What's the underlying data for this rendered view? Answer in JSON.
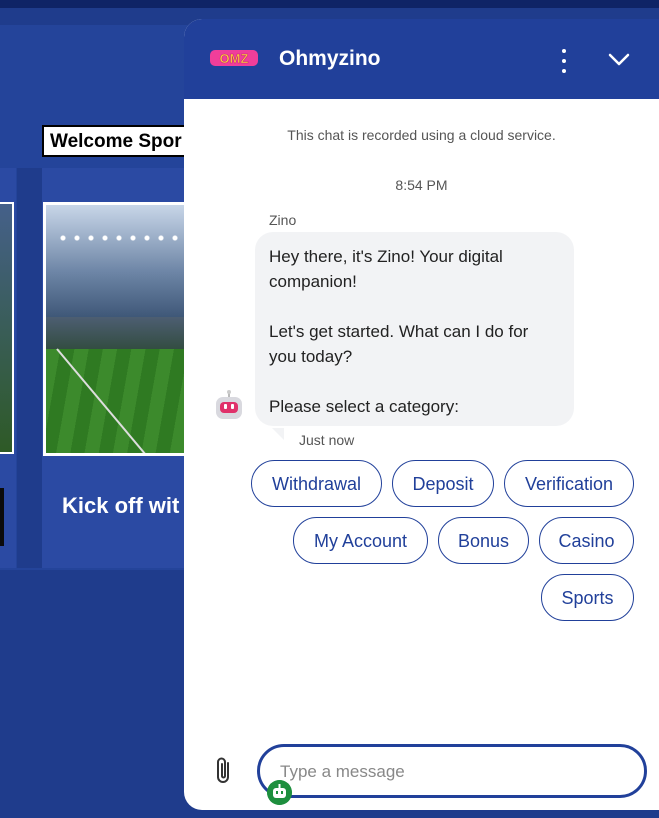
{
  "background": {
    "welcome_text": "Welcome Spor",
    "kickoff_text": "Kick off wit"
  },
  "chat": {
    "brand_logo_text": "OMZ",
    "brand_name": "Ohmyzino",
    "menu_icon": "kebab-menu-icon",
    "collapse_icon": "chevron-down-icon",
    "notice": "This chat is recorded using a cloud service.",
    "timestamp": "8:54 PM",
    "sender": "Zino",
    "message": {
      "line1": "Hey there, it's Zino! Your digital companion!",
      "line2": "Let's get started. What can I do for you today?",
      "line3": "Please select a category:"
    },
    "message_time": "Just now",
    "categories": [
      "Withdrawal",
      "Deposit",
      "Verification",
      "My Account",
      "Bonus",
      "Casino",
      "Sports"
    ],
    "input_placeholder": "Type a message",
    "attach_icon": "paperclip-icon",
    "colors": {
      "header": "#21409a",
      "page_bg": "#1f3c8c",
      "bubble": "#f2f3f5",
      "chip_border": "#21409a"
    }
  }
}
